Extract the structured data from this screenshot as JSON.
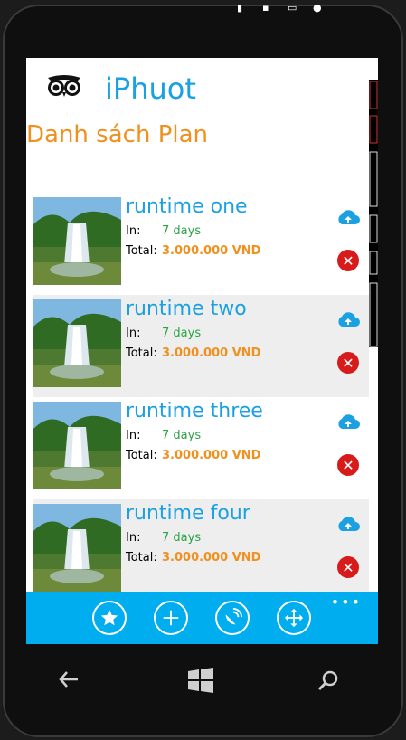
{
  "header": {
    "title": "iPhuot"
  },
  "page": {
    "title": "Danh sách Plan"
  },
  "plans": [
    {
      "name": "runtime one",
      "in_label": "In:",
      "days": "7 days",
      "total_label": "Total:",
      "total": "3.000.000 VND"
    },
    {
      "name": "runtime two",
      "in_label": "In:",
      "days": "7 days",
      "total_label": "Total:",
      "total": "3.000.000 VND"
    },
    {
      "name": "runtime three",
      "in_label": "In:",
      "days": "7 days",
      "total_label": "Total:",
      "total": "3.000.000 VND"
    },
    {
      "name": "runtime four",
      "in_label": "In:",
      "days": "7 days",
      "total_label": "Total:",
      "total": "3.000.000 VND"
    }
  ],
  "app_bar": {
    "buttons": [
      "star-icon",
      "add-icon",
      "satellite-icon",
      "move-icon"
    ],
    "more": "•••"
  },
  "colors": {
    "accent": "#1ba1e2",
    "orange": "#f0901e",
    "green": "#2aa345",
    "bar": "#00aef0",
    "delete": "#d71a1a"
  }
}
